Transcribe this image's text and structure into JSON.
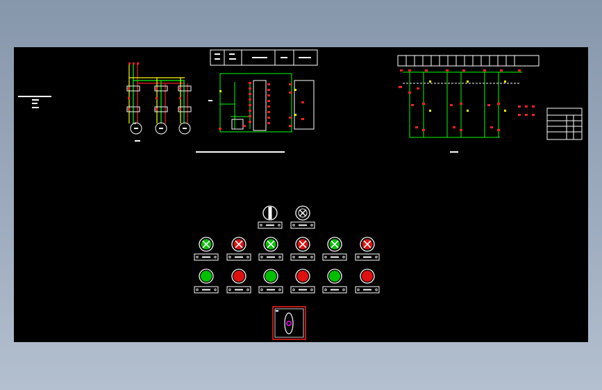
{
  "colors": {
    "background_gradient_top": "#8797ab",
    "canvas": "#000000",
    "wire": "#ffffff",
    "green_lamp": "#00c000",
    "red_lamp": "#e01010",
    "terminal_red": "#ff2020",
    "trace_green": "#00ff00",
    "magenta": "#ff00ff"
  },
  "panel": {
    "top_row": [
      {
        "type": "selector-switch",
        "state": "neutral"
      },
      {
        "type": "indicator-lamp",
        "state": "off"
      }
    ],
    "indicator_lamps": [
      "green",
      "red",
      "green",
      "red",
      "green",
      "red"
    ],
    "pushbuttons": [
      "green",
      "red",
      "green",
      "red",
      "green",
      "red"
    ],
    "emergency_box": {
      "icon": "oval-selector",
      "accent": "magenta"
    }
  }
}
